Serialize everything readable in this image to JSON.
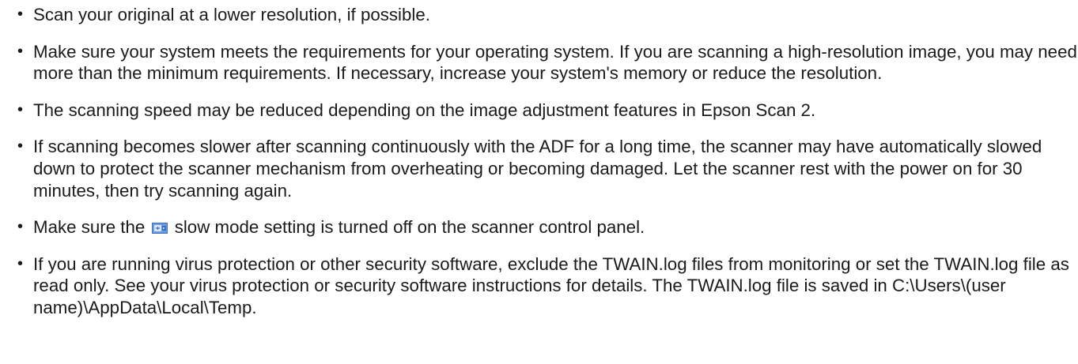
{
  "bullet_symbol": "•",
  "items": [
    {
      "text": "Scan your original at a lower resolution, if possible."
    },
    {
      "text": "Make sure your system meets the requirements for your operating system. If you are scanning a high-resolution image, you may need more than the minimum requirements. If necessary, increase your system's memory or reduce the resolution."
    },
    {
      "text": "The scanning speed may be reduced depending on the image adjustment features in Epson Scan 2."
    },
    {
      "text": "If scanning becomes slower after scanning continuously with the ADF for a long time, the scanner may have automatically slowed down to protect the scanner mechanism from overheating or becoming damaged. Let the scanner rest with the power on for 30 minutes, then try scanning again."
    },
    {
      "text_before": "Make sure the",
      "icon": "slow-mode-icon",
      "text_after": "slow mode setting is turned off on the scanner control panel."
    },
    {
      "text": "If you are running virus protection or other security software, exclude the TWAIN.log files from monitoring or set the TWAIN.log file as read only. See your virus protection or security software instructions for details. The TWAIN.log file is saved in C:\\Users\\(user name)\\AppData\\Local\\Temp."
    }
  ]
}
